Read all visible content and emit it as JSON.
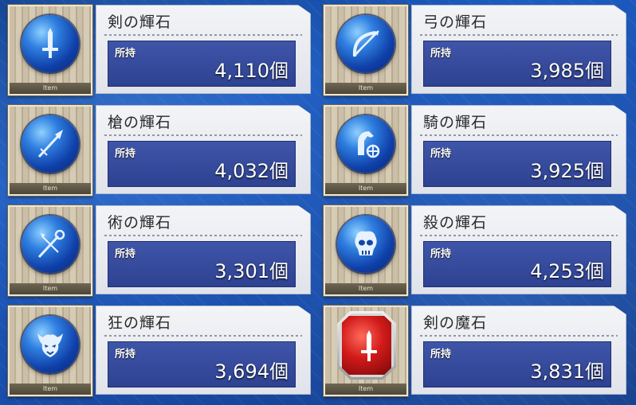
{
  "items": [
    {
      "name": "剣の輝石",
      "own_label": "所持",
      "count": "4,110個",
      "thumb_label": "Item",
      "icon": "sword-icon",
      "kind": "orb"
    },
    {
      "name": "弓の輝石",
      "own_label": "所持",
      "count": "3,985個",
      "thumb_label": "Item",
      "icon": "bow-icon",
      "kind": "orb"
    },
    {
      "name": "槍の輝石",
      "own_label": "所持",
      "count": "4,032個",
      "thumb_label": "Item",
      "icon": "spear-icon",
      "kind": "orb"
    },
    {
      "name": "騎の輝石",
      "own_label": "所持",
      "count": "3,925個",
      "thumb_label": "Item",
      "icon": "horse-icon",
      "kind": "orb"
    },
    {
      "name": "術の輝石",
      "own_label": "所持",
      "count": "3,301個",
      "thumb_label": "Item",
      "icon": "staff-icon",
      "kind": "orb"
    },
    {
      "name": "殺の輝石",
      "own_label": "所持",
      "count": "4,253個",
      "thumb_label": "Item",
      "icon": "skull-icon",
      "kind": "orb"
    },
    {
      "name": "狂の輝石",
      "own_label": "所持",
      "count": "3,694個",
      "thumb_label": "Item",
      "icon": "beast-icon",
      "kind": "orb"
    },
    {
      "name": "剣の魔石",
      "own_label": "所持",
      "count": "3,831個",
      "thumb_label": "Item",
      "icon": "sword-icon",
      "kind": "gem"
    }
  ]
}
